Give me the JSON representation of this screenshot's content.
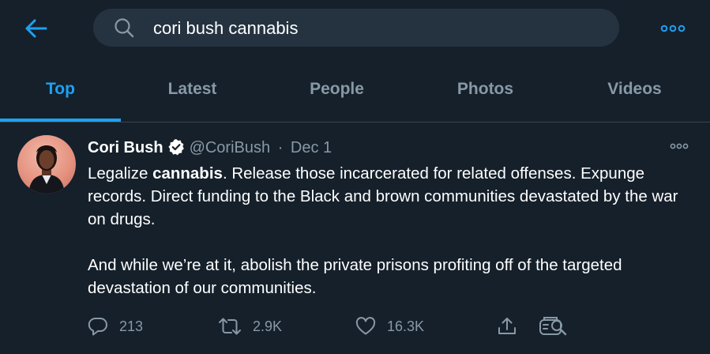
{
  "search": {
    "query": "cori bush cannabis"
  },
  "tabs": [
    {
      "label": "Top",
      "active": true
    },
    {
      "label": "Latest",
      "active": false
    },
    {
      "label": "People",
      "active": false
    },
    {
      "label": "Photos",
      "active": false
    },
    {
      "label": "Videos",
      "active": false
    }
  ],
  "tweet": {
    "author_name": "Cori Bush",
    "handle": "@CoriBush",
    "separator": "·",
    "date": "Dec 1",
    "p1_before": "Legalize ",
    "p1_keyword": "cannabis",
    "p1_after": ". Release those incarcerated for related offenses. Expunge records. Direct funding to the Black and brown communities devastated by the war on drugs.",
    "p2": "And while we’re at it, abolish the private prisons profiting off of the targeted devastation of our communities.",
    "replies": "213",
    "retweets": "2.9K",
    "likes": "16.3K"
  },
  "icons": {
    "back": "arrow-left-icon",
    "search": "search-icon",
    "more": "more-horizontal-icon",
    "verified": "verified-badge-icon",
    "reply": "reply-icon",
    "retweet": "retweet-icon",
    "like": "heart-icon",
    "share": "share-icon",
    "tip": "tip-jar-icon"
  },
  "colors": {
    "background": "#15202b",
    "accent": "#1da1f2",
    "muted": "#8899a6",
    "search_bg": "#253341",
    "divider": "#38444d"
  }
}
